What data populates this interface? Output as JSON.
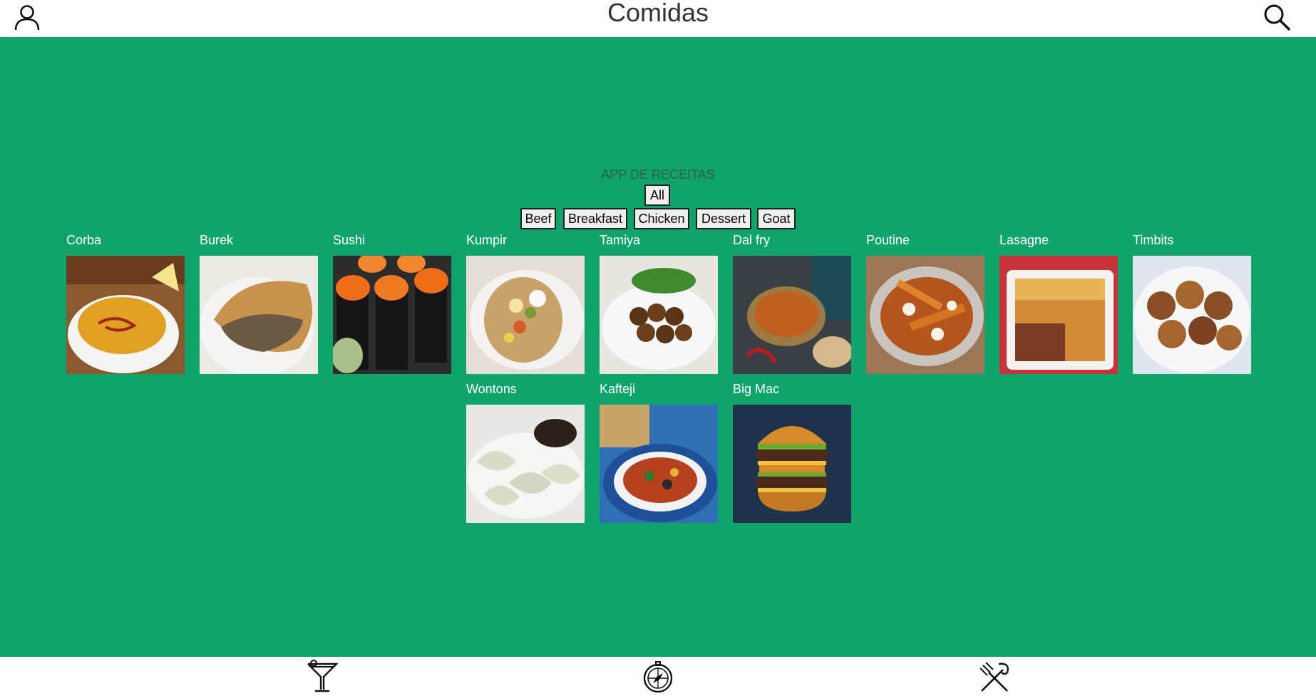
{
  "header": {
    "title": "Comidas",
    "profile_icon": "profile-icon",
    "search_icon": "search-icon"
  },
  "main": {
    "app_title": "APP DE RECEITAS",
    "filters": {
      "all": "All",
      "categories": [
        "Beef",
        "Breakfast",
        "Chicken",
        "Dessert",
        "Goat"
      ]
    },
    "recipes": [
      {
        "name": "Corba"
      },
      {
        "name": "Burek"
      },
      {
        "name": "Sushi"
      },
      {
        "name": "Kumpir"
      },
      {
        "name": "Tamiya"
      },
      {
        "name": "Dal fry"
      },
      {
        "name": "Poutine"
      },
      {
        "name": "Lasagne"
      },
      {
        "name": "Timbits"
      },
      {
        "name": "Wontons"
      },
      {
        "name": "Kafteji"
      },
      {
        "name": "Big Mac"
      }
    ]
  },
  "footer": {
    "icons": [
      "drink-icon",
      "explore-icon",
      "food-icon"
    ]
  },
  "colors": {
    "background": "#10a36b",
    "bar": "#ffffff",
    "title_text": "#333333",
    "card_text": "#ffffff"
  }
}
